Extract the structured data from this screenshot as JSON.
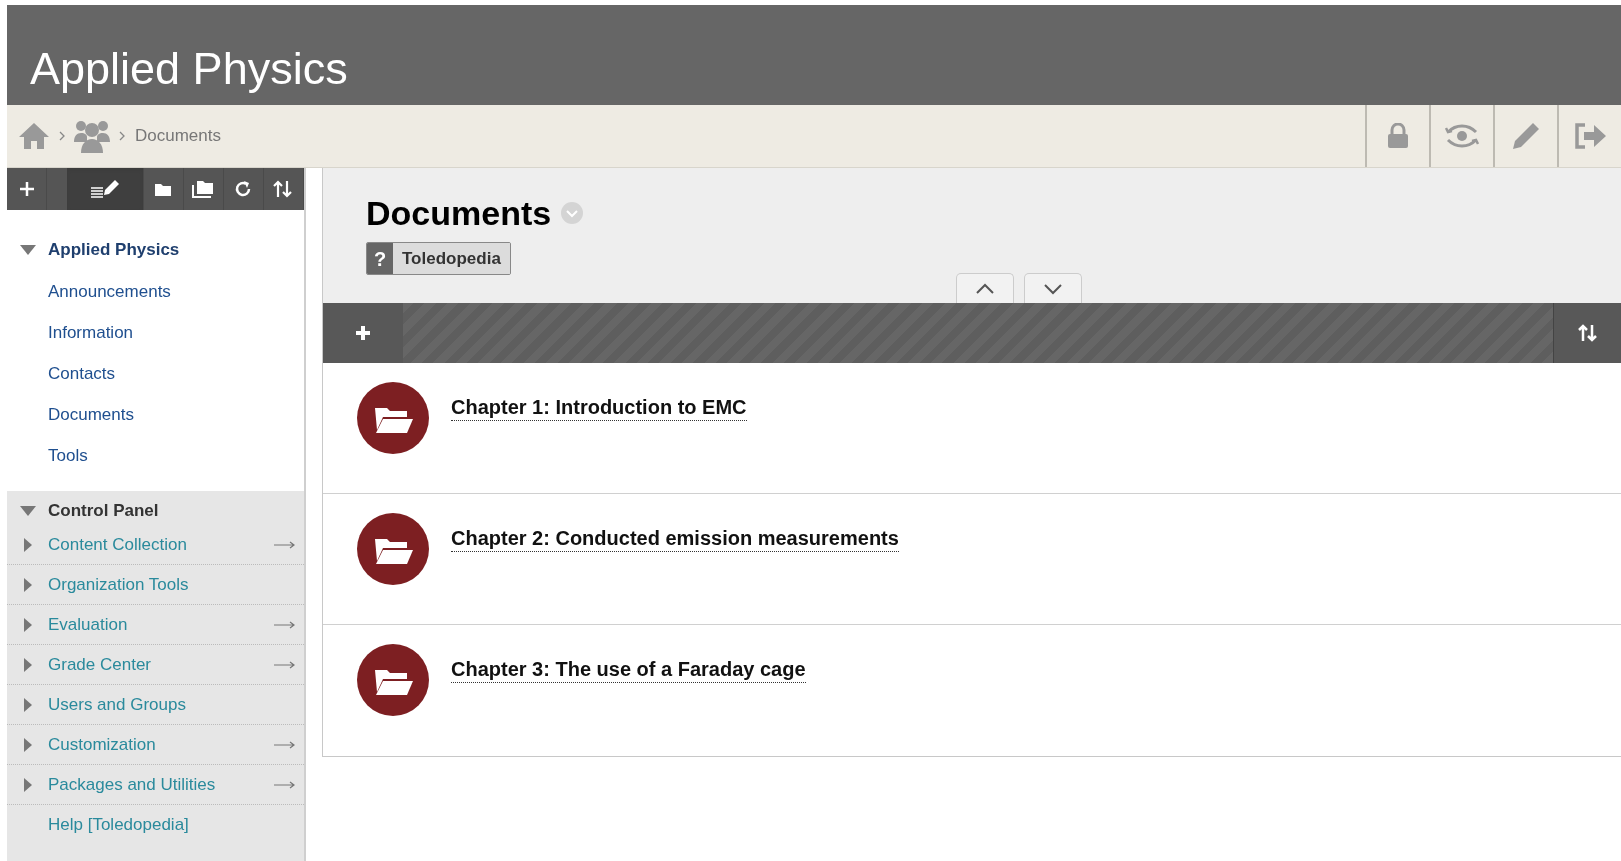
{
  "header": {
    "title": "Applied Physics"
  },
  "breadcrumb": {
    "items": [
      {
        "kind": "home"
      },
      {
        "kind": "group"
      },
      {
        "kind": "text",
        "label": "Documents"
      }
    ]
  },
  "top_actions": [
    {
      "kind": "lock"
    },
    {
      "kind": "view"
    },
    {
      "kind": "edit"
    },
    {
      "kind": "exit"
    }
  ],
  "sidebar": {
    "toolbar": [
      {
        "kind": "add",
        "selected": false
      },
      {
        "kind": "edit",
        "selected": true
      },
      {
        "kind": "folder",
        "selected": false
      },
      {
        "kind": "folders",
        "selected": false
      },
      {
        "kind": "refresh",
        "selected": false
      },
      {
        "kind": "sort",
        "selected": false
      }
    ],
    "course_menu": {
      "title": "Applied Physics",
      "expanded": true,
      "items": [
        {
          "label": "Announcements"
        },
        {
          "label": "Information"
        },
        {
          "label": "Contacts"
        },
        {
          "label": "Documents"
        },
        {
          "label": "Tools"
        }
      ]
    },
    "control_panel": {
      "title": "Control Panel",
      "expanded": true,
      "items": [
        {
          "label": "Content Collection",
          "expandable": true,
          "has_arrow": true
        },
        {
          "label": "Organization Tools",
          "expandable": true,
          "has_arrow": false
        },
        {
          "label": "Evaluation",
          "expandable": true,
          "has_arrow": true
        },
        {
          "label": "Grade Center",
          "expandable": true,
          "has_arrow": true
        },
        {
          "label": "Users and Groups",
          "expandable": true,
          "has_arrow": false
        },
        {
          "label": "Customization",
          "expandable": true,
          "has_arrow": true
        },
        {
          "label": "Packages and Utilities",
          "expandable": true,
          "has_arrow": true
        },
        {
          "label": "Help [Toledopedia]",
          "expandable": false,
          "has_arrow": false
        }
      ]
    }
  },
  "content": {
    "title": "Documents",
    "help_badge": {
      "icon": "?",
      "label": "Toledopedia"
    },
    "items": [
      {
        "title": "Chapter 1: Introduction to EMC"
      },
      {
        "title": "Chapter 2: Conducted emission measurements"
      },
      {
        "title": "Chapter 3: The use of a Faraday cage"
      }
    ]
  }
}
